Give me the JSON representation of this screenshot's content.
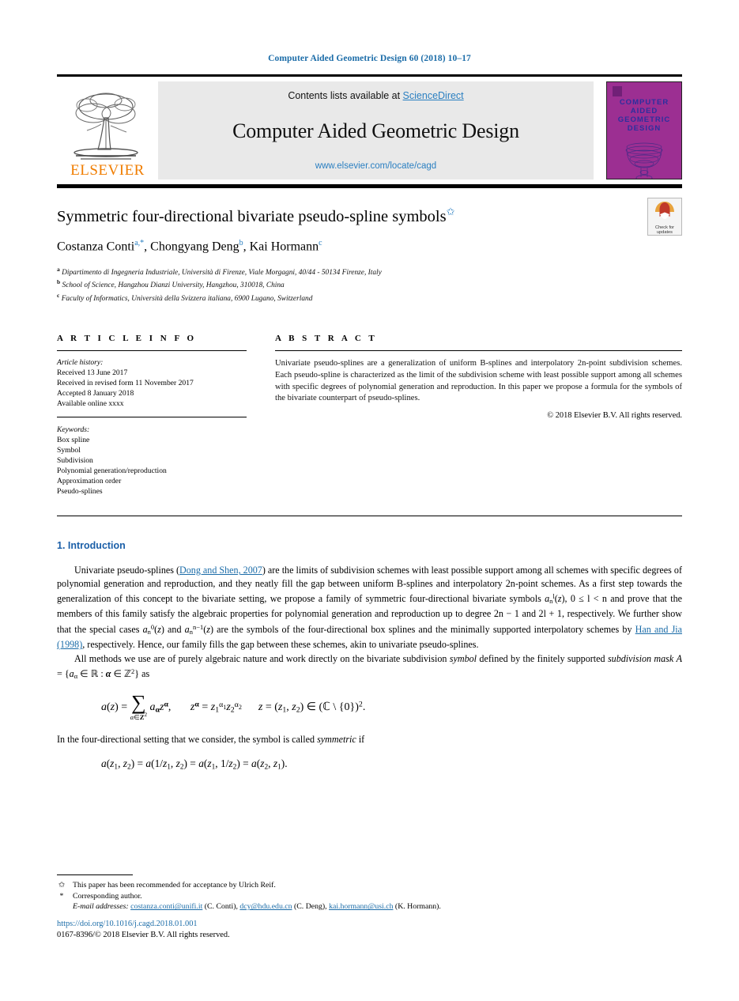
{
  "running_head": "Computer Aided Geometric Design 60 (2018) 10–17",
  "masthead": {
    "contents_prefix": "Contents lists available at ",
    "sciencedirect": "ScienceDirect",
    "journal_title": "Computer Aided Geometric Design",
    "journal_url": "www.elsevier.com/locate/cagd",
    "publisher": "ELSEVIER",
    "cover_title": "COMPUTER\nAIDED\nGEOMETRIC\nDESIGN",
    "cover_color": "#9c2f92",
    "cover_text_color": "#2d2f9e",
    "accent_color": "#2a7fc1",
    "elsevier_orange": "#F07D00"
  },
  "title": {
    "text": "Symmetric four-directional bivariate pseudo-spline symbols",
    "star": "✩"
  },
  "authors": [
    {
      "name": "Costanza Conti",
      "marks": "a,*"
    },
    {
      "name": "Chongyang Deng",
      "marks": "b"
    },
    {
      "name": "Kai Hormann",
      "marks": "c"
    }
  ],
  "authors_line_separator": ", ",
  "affiliations": [
    {
      "label": "a",
      "text": "Dipartimento di Ingegneria Industriale, Università di Firenze, Viale Morgagni, 40/44 - 50134 Firenze, Italy"
    },
    {
      "label": "b",
      "text": "School of Science, Hangzhou Dianzi University, Hangzhou, 310018, China"
    },
    {
      "label": "c",
      "text": "Faculty of Informatics, Università della Svizzera italiana, 6900 Lugano, Switzerland"
    }
  ],
  "crossmark": {
    "line1": "Check for",
    "line2": "updates"
  },
  "article_info": {
    "heading": "A R T I C L E   I N F O",
    "history_label": "Article history:",
    "history": [
      "Received 13 June 2017",
      "Received in revised form 11 November 2017",
      "Accepted 8 January 2018",
      "Available online xxxx"
    ],
    "keywords_label": "Keywords:",
    "keywords": [
      "Box spline",
      "Symbol",
      "Subdivision",
      "Polynomial generation/reproduction",
      "Approximation order",
      "Pseudo-splines"
    ]
  },
  "abstract": {
    "heading": "A B S T R A C T",
    "body": "Univariate pseudo-splines are a generalization of uniform B-splines and interpolatory 2n-point subdivision schemes. Each pseudo-spline is characterized as the limit of the subdivision scheme with least possible support among all schemes with specific degrees of polynomial generation and reproduction. In this paper we propose a formula for the symbols of the bivariate counterpart of pseudo-splines.",
    "copyright": "© 2018 Elsevier B.V. All rights reserved."
  },
  "introduction": {
    "heading": "1. Introduction",
    "para1_a": "Univariate pseudo-splines (",
    "para1_cite1": "Dong and Shen, 2007",
    "para1_b": ") are the limits of subdivision schemes with least possible support among all schemes with specific degrees of polynomial generation and reproduction, and they neatly fill the gap between uniform B-splines and interpolatory 2n-point schemes. As a first step towards the generalization of this concept to the bivariate setting, we propose a family of symmetric four-directional bivariate symbols ",
    "para1_c": ", 0 ≤ l < n and prove that the members of this family satisfy the algebraic properties for polynomial generation and reproduction up to degree 2n − 1 and 2l + 1, respectively. We further show that the special cases ",
    "para1_d": " and ",
    "para1_e": " are the symbols of the four-directional box splines and the minimally supported interpolatory schemes by ",
    "para1_cite2": "Han and Jia (1998)",
    "para1_f": ", respectively. Hence, our family fills the gap between these schemes, akin to univariate pseudo-splines.",
    "para2_a": "All methods we use are of purely algebraic nature and work directly on the bivariate subdivision ",
    "para2_sym": "symbol",
    "para2_b": " defined by the finitely supported ",
    "para2_mask": "subdivision mask",
    "para2_c": " A = {aα ∈ ℝ : α ∈ ℤ²} as",
    "para3": "In the four-directional setting that we consider, the symbol is called symmetric if",
    "equation1": "a(z) = Σ(α∈ℤ²) aα z^α,    z^α = z₁^α₁ z₂^α₂    z = (z₁, z₂) ∈ (ℂ \\ {0})².",
    "equation2": "a(z₁, z₂) = a(1/z₁, z₂) = a(z₁, 1/z₂) = a(z₂, z₁)."
  },
  "footnotes": [
    {
      "mark": "✩",
      "text": "This paper has been recommended for acceptance by Ulrich Reif."
    },
    {
      "mark": "*",
      "text": "Corresponding author."
    }
  ],
  "email_footnote": {
    "label": "E-mail addresses:",
    "entries": [
      {
        "email": "costanza.conti@unifi.it",
        "who": " (C. Conti), "
      },
      {
        "email": "dcy@hdu.edu.cn",
        "who": " (C. Deng), "
      },
      {
        "email": "kai.hormann@usi.ch",
        "who": " (K. Hormann)."
      }
    ]
  },
  "imprint": {
    "doi": "https://doi.org/10.1016/j.cagd.2018.01.001",
    "issn_copyright": "0167-8396/© 2018 Elsevier B.V. All rights reserved."
  }
}
